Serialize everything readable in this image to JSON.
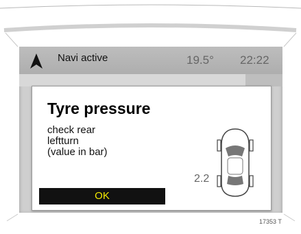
{
  "statusbar": {
    "nav_icon": "navigation-arrow-icon",
    "navi_text": "Navi active",
    "temperature": "19.5°",
    "clock": "22:22"
  },
  "dialog": {
    "title": "Tyre pressure",
    "lines": [
      "check rear",
      "leftturn",
      "(value in bar)"
    ],
    "pressure_value": "2.2",
    "car_icon": "car-top-view-icon",
    "ok_label": "OK"
  },
  "colors": {
    "ok_button_bg": "#111111",
    "ok_button_text": "#f4ea00",
    "screen_bg": "#cfcfcf"
  },
  "figure_ref": "17353 T"
}
